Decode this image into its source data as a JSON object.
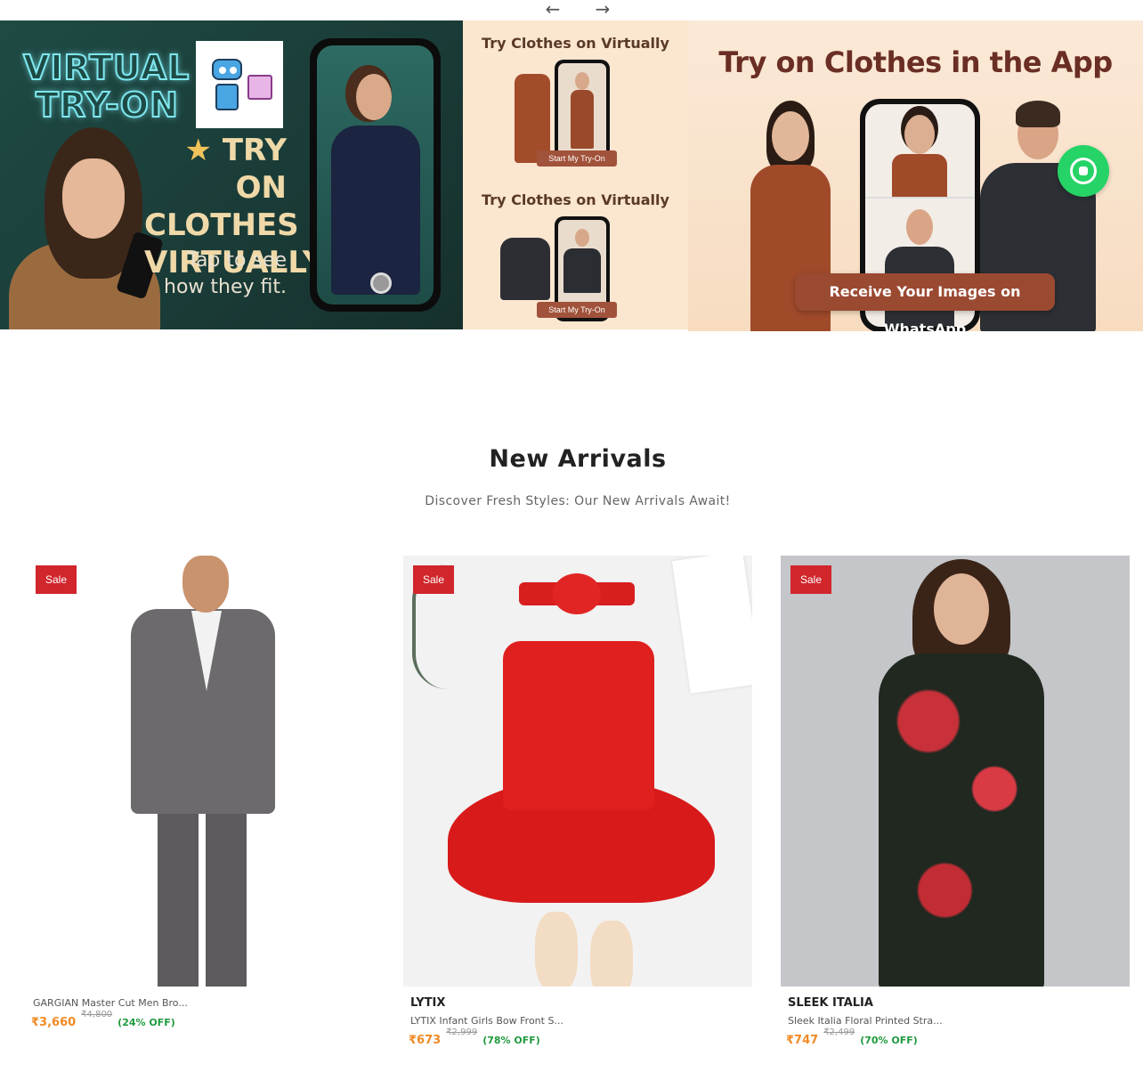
{
  "carousel": {
    "prev_icon": "arrow-left-icon",
    "next_icon": "arrow-right-icon",
    "prev_glyph": "←",
    "next_glyph": "→",
    "banners": [
      {
        "neon_line1": "VIRTUAL",
        "neon_line2": "TRY-ON",
        "headline_line1": "TRY ON",
        "headline_line2": "CLOTHES",
        "headline_line3": "VIRTUALLY",
        "star": "★",
        "tagline_line1": "Tap to see",
        "tagline_line2": "how they fit."
      },
      {
        "title_top": "Try Clothes on Virtually",
        "title_bottom": "Try Clothes on Virtually",
        "button_top": "Start My Try-On",
        "button_bottom": "Start My Try-On"
      },
      {
        "title": "Try on Clothes in the App",
        "button": "Receive Your Images on WhatsApp",
        "icon": "whatsapp-icon"
      }
    ]
  },
  "section": {
    "title": "New Arrivals",
    "subtitle": "Discover Fresh Styles: Our New Arrivals Await!"
  },
  "products": [
    {
      "badge": "Sale",
      "brand": "",
      "name": "GARGIAN Master Cut Men Bro...",
      "price": "₹3,660",
      "mrp": "₹4,800",
      "discount": "(24% OFF)"
    },
    {
      "badge": "Sale",
      "brand": "LYTIX",
      "name": "LYTIX Infant Girls Bow Front S...",
      "price": "₹673",
      "mrp": "₹2,999",
      "discount": "(78% OFF)"
    },
    {
      "badge": "Sale",
      "brand": "SLEEK ITALIA",
      "name": "Sleek Italia Floral Printed Stra...",
      "price": "₹747",
      "mrp": "₹2,499",
      "discount": "(70% OFF)"
    }
  ],
  "colors": {
    "sale_badge": "#d0262c",
    "price": "#f08a24",
    "discount": "#1f9a3e",
    "whatsapp": "#25d366"
  }
}
